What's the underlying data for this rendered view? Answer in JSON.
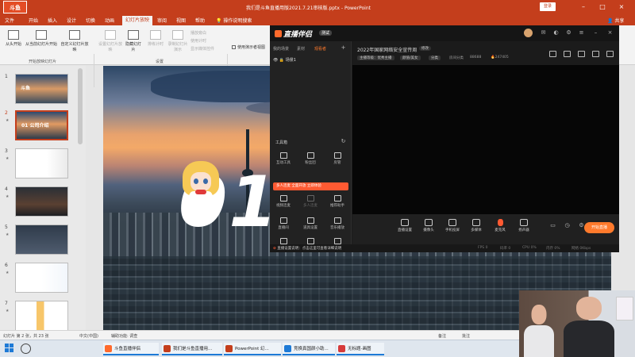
{
  "powerpoint": {
    "logo_text": "斗鱼",
    "title": "我们是斗鱼直播用版2021.7.21审核版.pptx  -  PowerPoint",
    "signin": "登录",
    "tabs": [
      "文件",
      "开始",
      "插入",
      "设计",
      "切换",
      "动画",
      "幻灯片放映",
      "审阅",
      "视图",
      "帮助",
      "操作说明搜索"
    ],
    "active_tab": "幻灯片放映",
    "share": "共享",
    "ribbon": {
      "from_start": "从头开始",
      "from_current": "从当前幻灯片开始",
      "custom_show": "自定义幻灯片放映",
      "setup_show": "设置幻灯片放映",
      "hide_slide": "隐藏幻灯片",
      "rehearse": "排练计时",
      "record": "录制幻灯片演示",
      "play_narration": "播放旁白",
      "use_timings": "使用计时",
      "show_media_controls": "显示媒体控件",
      "use_presenter_view": "使用演示者视图",
      "group_start": "开始放映幻灯片",
      "group_setup": "设置"
    },
    "slide_thumbnails": [
      {
        "num": "1",
        "text": "斗鱼"
      },
      {
        "num": "2",
        "text": "01 公司介绍"
      },
      {
        "num": "3",
        "text": ""
      },
      {
        "num": "4",
        "text": ""
      },
      {
        "num": "5",
        "text": ""
      },
      {
        "num": "6",
        "text": ""
      },
      {
        "num": "7",
        "text": ""
      }
    ],
    "slide": {
      "big_text": "01"
    },
    "status": {
      "slide_count": "幻灯片 第 2 张，共 23 张",
      "language": "中文(中国)",
      "accessibility": "辅助功能: 调查",
      "notes": "备注",
      "comments": "批注"
    }
  },
  "taskbar": {
    "items": [
      {
        "label": "斗鱼直播伴侣",
        "color": "#ff6a2c"
      },
      {
        "label": "我们是斗鱼直播用...",
        "color": "#c43e1c"
      },
      {
        "label": "PowerPoint 幻...",
        "color": "#c43e1c"
      },
      {
        "label": "竞换真国颜小助...",
        "color": "#1e7ad6"
      },
      {
        "label": "无标题-画图",
        "color": "#d63a3a"
      }
    ]
  },
  "stream_app": {
    "logo": "直播伴侣",
    "version_tag": "测试",
    "left_tabs": [
      "我的场景",
      "素材",
      "观看者"
    ],
    "active_left_tab": "观看者",
    "scene_name": "场景1",
    "tools_title": "工具箱",
    "tools": [
      {
        "label": "互动工具",
        "disabled": false
      },
      {
        "label": "粉丝团",
        "disabled": false
      },
      {
        "label": "房管",
        "disabled": false
      },
      {
        "label": "设置",
        "disabled": false
      },
      {
        "label": "视频连麦",
        "disabled": false
      },
      {
        "label": "多人连麦",
        "disabled": true
      },
      {
        "label": "推荐助手",
        "disabled": false
      },
      {
        "label": "直播间",
        "disabled": false
      },
      {
        "label": "道具设置",
        "disabled": false
      },
      {
        "label": "音乐播放",
        "disabled": false
      },
      {
        "label": "白板",
        "disabled": false
      },
      {
        "label": "特效",
        "disabled": false
      },
      {
        "label": "上传",
        "disabled": false
      }
    ],
    "banner": "多人连麦 全面开放 立即体验",
    "room_title": "2022年国家网络安全宣传周",
    "edit_label": "修改",
    "meta": [
      "主播等级：优秀主播",
      "颜值/美女",
      "分类",
      "房间分类",
      "88688",
      "247405"
    ],
    "bottom_buttons": [
      "直播设置",
      "摄像头",
      "手机投屏",
      "多媒体",
      "麦克风",
      "扬声器"
    ],
    "go_live": "开始直播",
    "warning": "直播设置说明：点击这里可查看详细说明",
    "footer_stats": [
      "FPS 0",
      "码率 0",
      "CPU 0%",
      "内存 0%",
      "网络 0Kbps"
    ]
  }
}
